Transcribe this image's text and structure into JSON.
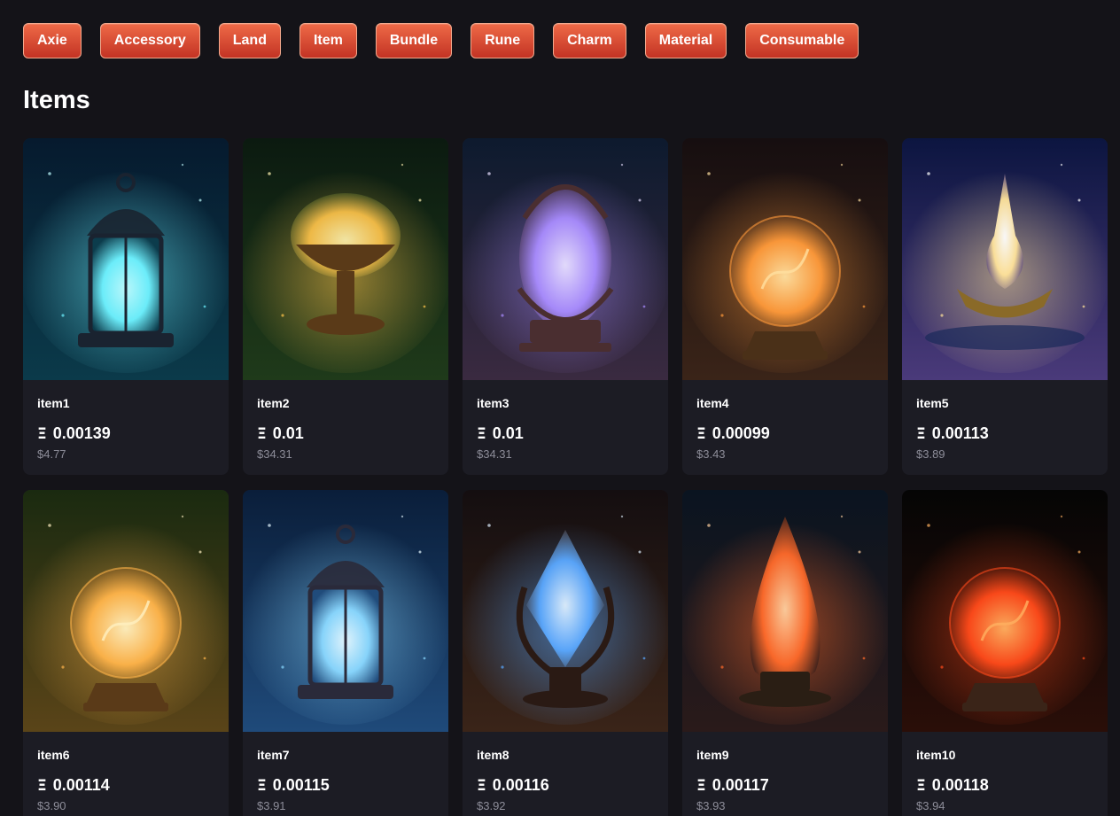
{
  "tabs": [
    "Axie",
    "Accessory",
    "Land",
    "Item",
    "Bundle",
    "Rune",
    "Charm",
    "Material",
    "Consumable"
  ],
  "section_title": "Items",
  "currency_symbol": "Ξ",
  "items": [
    {
      "name": "item1",
      "price": "0.00139",
      "usd": "$4.77",
      "art": {
        "bg1": "#061a2e",
        "bg2": "#0b3a4a",
        "glow": "#6ef2ff",
        "core": "#bffcff",
        "base": "#1a2330",
        "shape": "lantern"
      }
    },
    {
      "name": "item2",
      "price": "0.01",
      "usd": "$34.31",
      "art": {
        "bg1": "#0b1a10",
        "bg2": "#1f3a1a",
        "glow": "#ffc44a",
        "core": "#fff2b0",
        "base": "#5a3a18",
        "shape": "chalice"
      }
    },
    {
      "name": "item3",
      "price": "0.01",
      "usd": "$34.31",
      "art": {
        "bg1": "#0d1a2e",
        "bg2": "#3a2a40",
        "glow": "#a98cff",
        "core": "#e8e0ff",
        "base": "#4a2e30",
        "shape": "egg"
      }
    },
    {
      "name": "item4",
      "price": "0.00099",
      "usd": "$3.43",
      "art": {
        "bg1": "#160e10",
        "bg2": "#3a2418",
        "glow": "#ff9a3a",
        "core": "#ffe0a0",
        "base": "#4a3018",
        "shape": "orb"
      }
    },
    {
      "name": "item5",
      "price": "0.00113",
      "usd": "$3.89",
      "art": {
        "bg1": "#0c1540",
        "bg2": "#4a3a7a",
        "glow": "#ffe39a",
        "core": "#ffffff",
        "base": "#8a6a28",
        "shape": "lamp"
      }
    },
    {
      "name": "item6",
      "price": "0.00114",
      "usd": "$3.90",
      "art": {
        "bg1": "#1a2a10",
        "bg2": "#5a4418",
        "glow": "#ffb44a",
        "core": "#fff0c0",
        "base": "#5a3a18",
        "shape": "orb"
      }
    },
    {
      "name": "item7",
      "price": "0.00115",
      "usd": "$3.91",
      "art": {
        "bg1": "#0a1e3a",
        "bg2": "#1f4a7a",
        "glow": "#8ad8ff",
        "core": "#e6f8ff",
        "base": "#2a2a3a",
        "shape": "lantern"
      }
    },
    {
      "name": "item8",
      "price": "0.00116",
      "usd": "$3.92",
      "art": {
        "bg1": "#140e10",
        "bg2": "#3a2418",
        "glow": "#5aa8ff",
        "core": "#dff0ff",
        "base": "#2a1a14",
        "shape": "crystal"
      }
    },
    {
      "name": "item9",
      "price": "0.00117",
      "usd": "$3.93",
      "art": {
        "bg1": "#0a1420",
        "bg2": "#2a1a1a",
        "glow": "#ff6a2a",
        "core": "#ffd0a0",
        "base": "#2a1e14",
        "shape": "drop"
      }
    },
    {
      "name": "item10",
      "price": "0.00118",
      "usd": "$3.94",
      "art": {
        "bg1": "#050505",
        "bg2": "#2a0e08",
        "glow": "#ff4a1a",
        "core": "#ffb060",
        "base": "#3a2418",
        "shape": "orb"
      }
    }
  ]
}
